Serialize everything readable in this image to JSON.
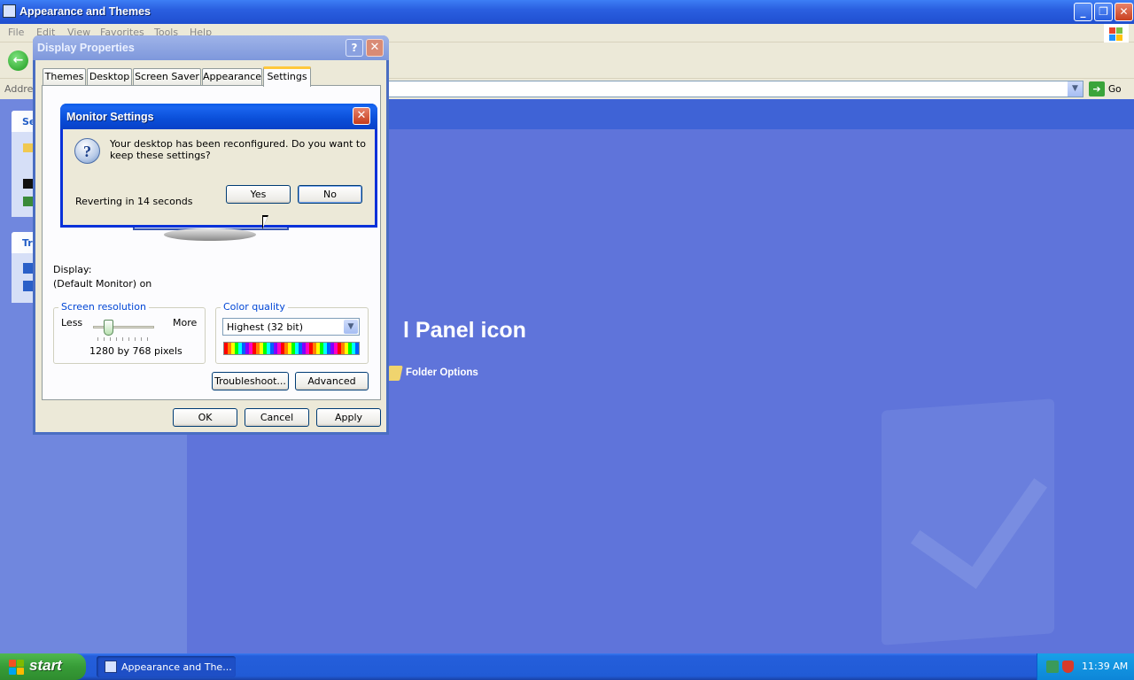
{
  "explorer": {
    "title": "Appearance and Themes",
    "menu": [
      "File",
      "Edit",
      "View",
      "Favorites",
      "Tools",
      "Help"
    ],
    "address_label": "Address",
    "go_label": "Go",
    "sidebar": {
      "box1_title": "Se",
      "box2_title": "Tr"
    },
    "panel_title": "l Panel icon",
    "folder_options": "Folder Options"
  },
  "display_properties": {
    "title": "Display Properties",
    "help_glyph": "?",
    "close_glyph": "✕",
    "tabs": [
      "Themes",
      "Desktop",
      "Screen Saver",
      "Appearance",
      "Settings"
    ],
    "active_tab": "Settings",
    "display_label": "Display:",
    "display_value": "(Default Monitor) on",
    "screen_resolution": {
      "title": "Screen resolution",
      "less": "Less",
      "more": "More",
      "value": "1280 by 768 pixels",
      "slider_position": 0.2
    },
    "color_quality": {
      "title": "Color quality",
      "selected": "Highest (32 bit)"
    },
    "buttons": {
      "troubleshoot": "Troubleshoot...",
      "advanced": "Advanced",
      "ok": "OK",
      "cancel": "Cancel",
      "apply": "Apply"
    }
  },
  "monitor_settings": {
    "title": "Monitor Settings",
    "close_glyph": "✕",
    "icon_glyph": "?",
    "message": "Your desktop has been reconfigured.  Do you want to keep these settings?",
    "reverting": "Reverting in 14 seconds",
    "yes": "Yes",
    "no": "No"
  },
  "taskbar": {
    "start": "start",
    "task_item": "Appearance and The...",
    "clock": "11:39 AM"
  },
  "colors": {
    "desktop_blue": "#5f74da",
    "xp_title_blue": "#0a4ed8",
    "start_green": "#379c37",
    "group_title_blue": "#0046d5"
  }
}
